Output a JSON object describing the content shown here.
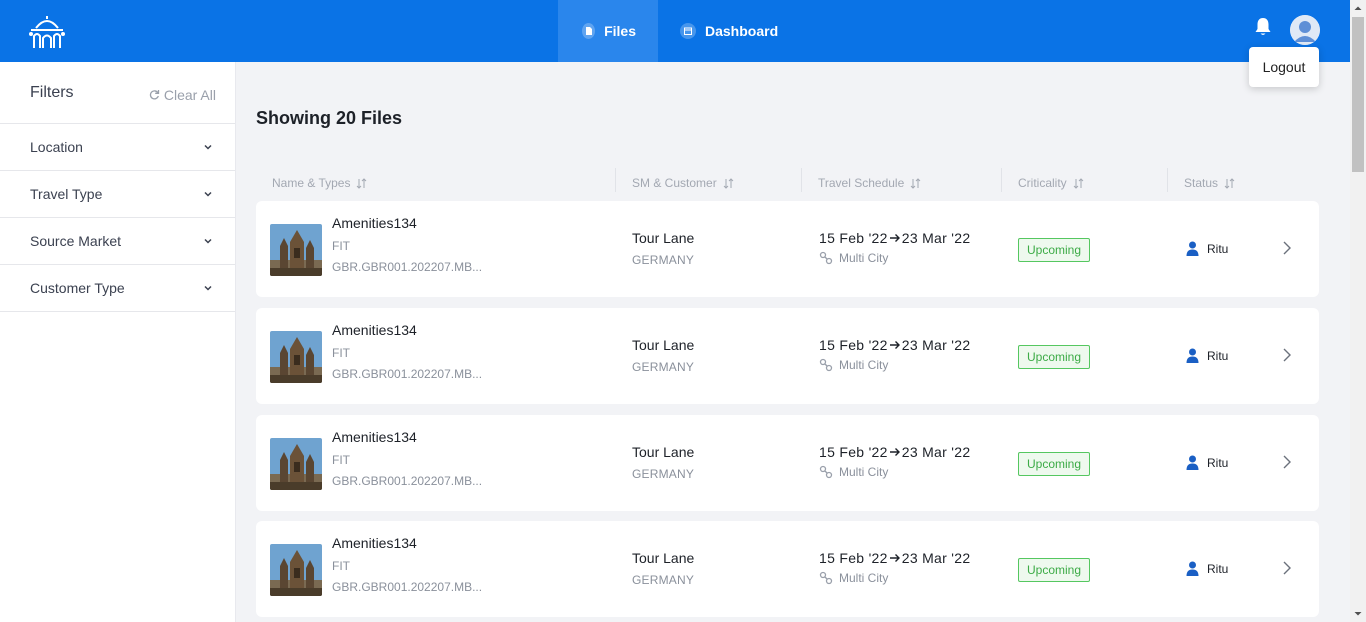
{
  "header": {
    "nav": [
      {
        "label": "Files",
        "icon": "file-icon",
        "active": true
      },
      {
        "label": "Dashboard",
        "icon": "calendar-icon",
        "active": false
      }
    ],
    "logout_label": "Logout",
    "brand_color": "#0a73e6"
  },
  "sidebar": {
    "title": "Filters",
    "clear_label": "Clear All",
    "filters": [
      {
        "label": "Location"
      },
      {
        "label": "Travel Type"
      },
      {
        "label": "Source Market"
      },
      {
        "label": "Customer Type"
      }
    ]
  },
  "main": {
    "heading": "Showing 20 Files",
    "columns": [
      "Name & Types",
      "SM & Customer",
      "Travel Schedule",
      "Criticality",
      "Status"
    ],
    "files": [
      {
        "name": "Amenities134",
        "type": "FIT",
        "ref": "GBR.GBR001.202207.MB...",
        "sm": "Tour Lane",
        "country": "GERMANY",
        "from": "15 Feb '22",
        "to": "23 Mar '22",
        "trip": "Multi City",
        "criticality": "Upcoming",
        "user": "Ritu"
      },
      {
        "name": "Amenities134",
        "type": "FIT",
        "ref": "GBR.GBR001.202207.MB...",
        "sm": "Tour Lane",
        "country": "GERMANY",
        "from": "15 Feb '22",
        "to": "23 Mar '22",
        "trip": "Multi City",
        "criticality": "Upcoming",
        "user": "Ritu"
      },
      {
        "name": "Amenities134",
        "type": "FIT",
        "ref": "GBR.GBR001.202207.MB...",
        "sm": "Tour Lane",
        "country": "GERMANY",
        "from": "15 Feb '22",
        "to": "23 Mar '22",
        "trip": "Multi City",
        "criticality": "Upcoming",
        "user": "Ritu"
      },
      {
        "name": "Amenities134",
        "type": "FIT",
        "ref": "GBR.GBR001.202207.MB...",
        "sm": "Tour Lane",
        "country": "GERMANY",
        "from": "15 Feb '22",
        "to": "23 Mar '22",
        "trip": "Multi City",
        "criticality": "Upcoming",
        "user": "Ritu"
      }
    ]
  }
}
